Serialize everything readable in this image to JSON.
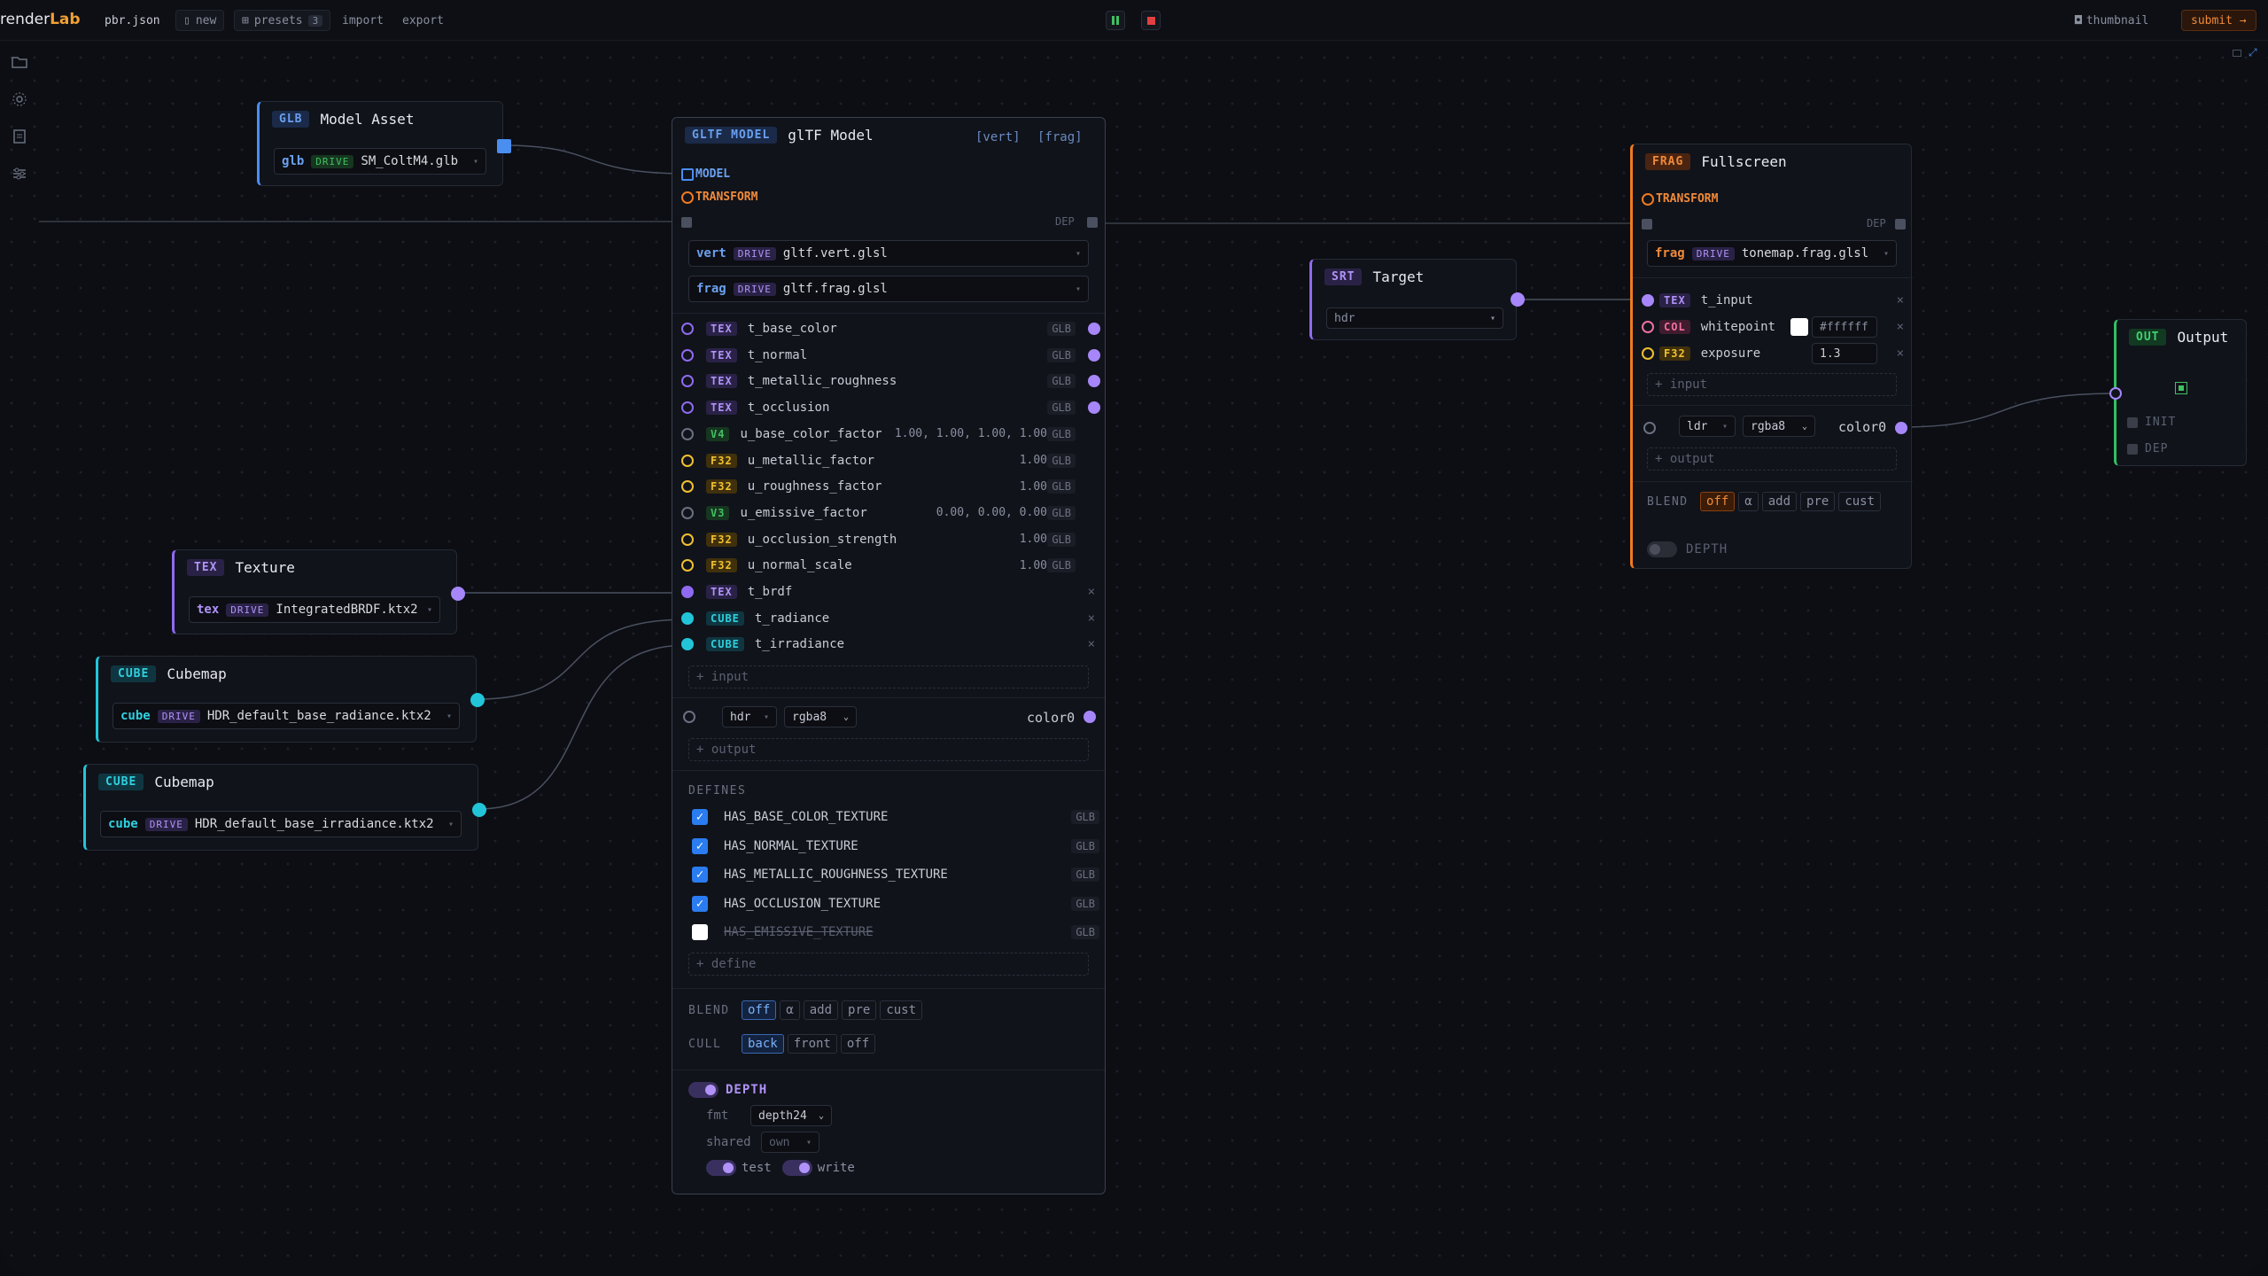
{
  "topbar": {
    "logo_prefix": "render",
    "logo_accent": "Lab",
    "file": "pbr.json",
    "new": "new",
    "presets": "presets",
    "presets_count": "3",
    "import": "import",
    "export": "export",
    "thumbnail": "thumbnail",
    "submit": "submit →"
  },
  "nodes": {
    "model_asset": {
      "tag": "GLB",
      "title": "Model Asset",
      "file_kind": "glb",
      "drive": "DRIVE",
      "file": "SM_ColtM4.glb"
    },
    "texture": {
      "tag": "TEX",
      "title": "Texture",
      "file_kind": "tex",
      "drive": "DRIVE",
      "file": "IntegratedBRDF.ktx2"
    },
    "cubemap1": {
      "tag": "CUBE",
      "title": "Cubemap",
      "file_kind": "cube",
      "drive": "DRIVE",
      "file": "HDR_default_base_radiance.ktx2"
    },
    "cubemap2": {
      "tag": "CUBE",
      "title": "Cubemap",
      "file_kind": "cube",
      "drive": "DRIVE",
      "file": "HDR_default_base_irradiance.ktx2"
    },
    "target": {
      "tag": "SRT",
      "title": "Target",
      "format": "hdr"
    },
    "output": {
      "tag": "OUT",
      "title": "Output",
      "init": "INIT",
      "dep": "DEP"
    },
    "gltf": {
      "tag": "GLTF MODEL",
      "title": "glTF Model",
      "vert_link": "[vert]",
      "frag_link": "[frag]",
      "model": "MODEL",
      "transform": "TRANSFORM",
      "dep": "DEP",
      "vert": {
        "kind": "vert",
        "drive": "DRIVE",
        "file": "gltf.vert.glsl"
      },
      "frag": {
        "kind": "frag",
        "drive": "DRIVE",
        "file": "gltf.frag.glsl"
      },
      "inputs": [
        {
          "tag": "TEX",
          "name": "t_base_color",
          "val": "",
          "badge": "GLB"
        },
        {
          "tag": "TEX",
          "name": "t_normal",
          "val": "",
          "badge": "GLB"
        },
        {
          "tag": "TEX",
          "name": "t_metallic_roughness",
          "val": "",
          "badge": "GLB"
        },
        {
          "tag": "TEX",
          "name": "t_occlusion",
          "val": "",
          "badge": "GLB"
        },
        {
          "tag": "V4",
          "name": "u_base_color_factor",
          "val": "1.00, 1.00, 1.00, 1.00",
          "badge": "GLB"
        },
        {
          "tag": "F32",
          "name": "u_metallic_factor",
          "val": "1.00",
          "badge": "GLB"
        },
        {
          "tag": "F32",
          "name": "u_roughness_factor",
          "val": "1.00",
          "badge": "GLB"
        },
        {
          "tag": "V3",
          "name": "u_emissive_factor",
          "val": "0.00, 0.00, 0.00",
          "badge": "GLB"
        },
        {
          "tag": "F32",
          "name": "u_occlusion_strength",
          "val": "1.00",
          "badge": "GLB"
        },
        {
          "tag": "F32",
          "name": "u_normal_scale",
          "val": "1.00",
          "badge": "GLB"
        },
        {
          "tag": "TEX",
          "name": "t_brdf",
          "val": "",
          "badge": "×"
        },
        {
          "tag": "CUBE",
          "name": "t_radiance",
          "val": "",
          "badge": "×"
        },
        {
          "tag": "CUBE",
          "name": "t_irradiance",
          "val": "",
          "badge": "×"
        }
      ],
      "add_input": "+ input",
      "out_target": "hdr",
      "out_format": "rgba8",
      "out_name": "color0",
      "add_output": "+ output",
      "defines_label": "DEFINES",
      "defines": [
        {
          "name": "HAS_BASE_COLOR_TEXTURE",
          "badge": "GLB",
          "checked": true
        },
        {
          "name": "HAS_NORMAL_TEXTURE",
          "badge": "GLB",
          "checked": true
        },
        {
          "name": "HAS_METALLIC_ROUGHNESS_TEXTURE",
          "badge": "GLB",
          "checked": true
        },
        {
          "name": "HAS_OCCLUSION_TEXTURE",
          "badge": "GLB",
          "checked": true
        },
        {
          "name": "HAS_EMISSIVE_TEXTURE",
          "badge": "GLB",
          "checked": false
        }
      ],
      "add_define": "+ define",
      "blend_label": "BLEND",
      "blend_opts": [
        "off",
        "α",
        "add",
        "pre",
        "cust"
      ],
      "cull_label": "CULL",
      "cull_opts": [
        "back",
        "front",
        "off"
      ],
      "depth_label": "DEPTH",
      "fmt_label": "fmt",
      "fmt_value": "depth24",
      "shared_label": "shared",
      "shared_value": "own",
      "test_label": "test",
      "write_label": "write"
    },
    "fullscreen": {
      "tag": "FRAG",
      "title": "Fullscreen",
      "transform": "TRANSFORM",
      "dep": "DEP",
      "frag": {
        "kind": "frag",
        "drive": "DRIVE",
        "file": "tonemap.frag.glsl"
      },
      "inputs": [
        {
          "tag": "TEX",
          "name": "t_input",
          "val": ""
        },
        {
          "tag": "COL",
          "name": "whitepoint",
          "val": "#ffffff"
        },
        {
          "tag": "F32",
          "name": "exposure",
          "val": "1.3"
        }
      ],
      "add_input": "+ input",
      "out_target": "ldr",
      "out_format": "rgba8",
      "out_name": "color0",
      "add_output": "+ output",
      "blend_label": "BLEND",
      "blend_opts": [
        "off",
        "α",
        "add",
        "pre",
        "cust"
      ],
      "depth_label": "DEPTH"
    }
  }
}
